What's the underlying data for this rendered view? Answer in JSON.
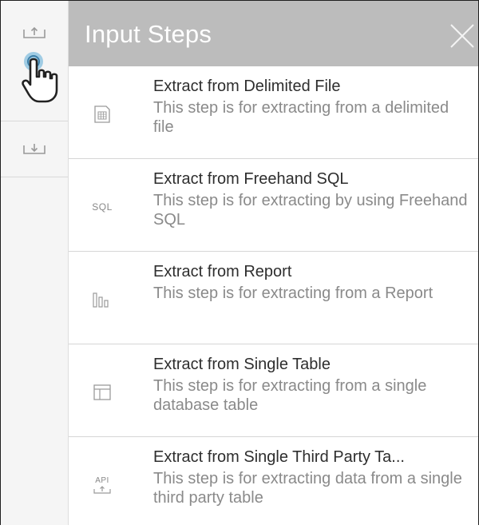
{
  "panel": {
    "title": "Input Steps",
    "close_icon": "close-icon"
  },
  "toolbar": {
    "items": [
      {
        "icon": "upload-icon"
      },
      {
        "icon": "download-icon"
      }
    ],
    "cursor_icon": "hand-pointer-icon"
  },
  "steps": [
    {
      "title": "Extract from Delimited File",
      "description": "This step is for extracting from a delimited file",
      "icon": "delimited-file-icon"
    },
    {
      "title": "Extract from Freehand SQL",
      "description": "This step is for extracting by using Freehand SQL",
      "icon": "sql-icon",
      "icon_text": "SQL"
    },
    {
      "title": "Extract from Report",
      "description": "This step is for extracting from a Report",
      "icon": "report-icon"
    },
    {
      "title": "Extract from Single Table",
      "description": "This step is for extracting from a single database table",
      "icon": "table-icon"
    },
    {
      "title": "Extract from Single Third Party Ta...",
      "description": "This step is for extracting data from a single third party table",
      "icon": "api-icon",
      "icon_text": "API"
    }
  ]
}
